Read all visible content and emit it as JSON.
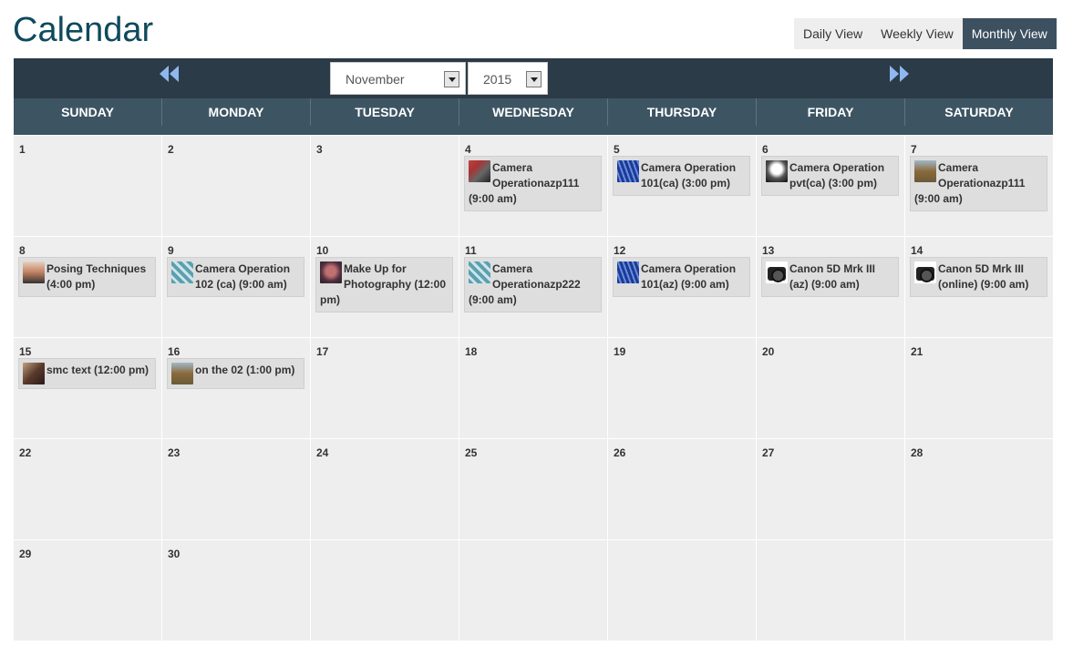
{
  "title": "Calendar",
  "views": [
    {
      "label": "Daily View",
      "active": false
    },
    {
      "label": "Weekly View",
      "active": false
    },
    {
      "label": "Monthly View",
      "active": true
    }
  ],
  "nav": {
    "month": "November",
    "year": "2015",
    "prev_icon": "double-left-arrow-icon",
    "next_icon": "double-right-arrow-icon"
  },
  "colors": {
    "title": "#0e4a5c",
    "nav_bar": "#2b3b47",
    "header_row": "#3d5563",
    "active_view": "#3d5060",
    "arrow": "#8fb8f0"
  },
  "weekdays": [
    "SUNDAY",
    "MONDAY",
    "TUESDAY",
    "WEDNESDAY",
    "THURSDAY",
    "FRIDAY",
    "SATURDAY"
  ],
  "weeks": [
    [
      {
        "day": "1"
      },
      {
        "day": "2"
      },
      {
        "day": "3"
      },
      {
        "day": "4",
        "event": {
          "text": "Camera Operationazp111 (9:00 am)",
          "thumb": "camera"
        }
      },
      {
        "day": "5",
        "event": {
          "text": "Camera Operation 101(ca) (3:00 pm)",
          "thumb": "blue"
        }
      },
      {
        "day": "6",
        "event": {
          "text": "Camera Operation pvt(ca) (3:00 pm)",
          "thumb": "bw"
        }
      },
      {
        "day": "7",
        "event": {
          "text": "Camera Operationazp111 (9:00 am)",
          "thumb": "tree"
        }
      }
    ],
    [
      {
        "day": "8",
        "event": {
          "text": "Posing Techniques (4:00 pm)",
          "thumb": "pose"
        }
      },
      {
        "day": "9",
        "event": {
          "text": "Camera Operation 102 (ca) (9:00 am)",
          "thumb": "ribbon"
        }
      },
      {
        "day": "10",
        "event": {
          "text": "Make Up for Photography (12:00 pm)",
          "thumb": "face"
        }
      },
      {
        "day": "11",
        "event": {
          "text": "Camera Operationazp222 (9:00 am)",
          "thumb": "ribbon"
        }
      },
      {
        "day": "12",
        "event": {
          "text": "Camera Operation 101(az) (9:00 am)",
          "thumb": "blue"
        }
      },
      {
        "day": "13",
        "event": {
          "text": "Canon 5D Mrk III (az) (9:00 am)",
          "thumb": "dslr"
        }
      },
      {
        "day": "14",
        "event": {
          "text": "Canon 5D Mrk III (online) (9:00 am)",
          "thumb": "dslr"
        }
      }
    ],
    [
      {
        "day": "15",
        "event": {
          "text": "smc text (12:00 pm)",
          "thumb": "smc"
        }
      },
      {
        "day": "16",
        "event": {
          "text": "on the 02 (1:00 pm)",
          "thumb": "tree"
        }
      },
      {
        "day": "17"
      },
      {
        "day": "18"
      },
      {
        "day": "19"
      },
      {
        "day": "20"
      },
      {
        "day": "21"
      }
    ],
    [
      {
        "day": "22"
      },
      {
        "day": "23"
      },
      {
        "day": "24"
      },
      {
        "day": "25"
      },
      {
        "day": "26"
      },
      {
        "day": "27"
      },
      {
        "day": "28"
      }
    ],
    [
      {
        "day": "29"
      },
      {
        "day": "30"
      },
      {
        "day": ""
      },
      {
        "day": ""
      },
      {
        "day": ""
      },
      {
        "day": ""
      },
      {
        "day": ""
      }
    ]
  ]
}
